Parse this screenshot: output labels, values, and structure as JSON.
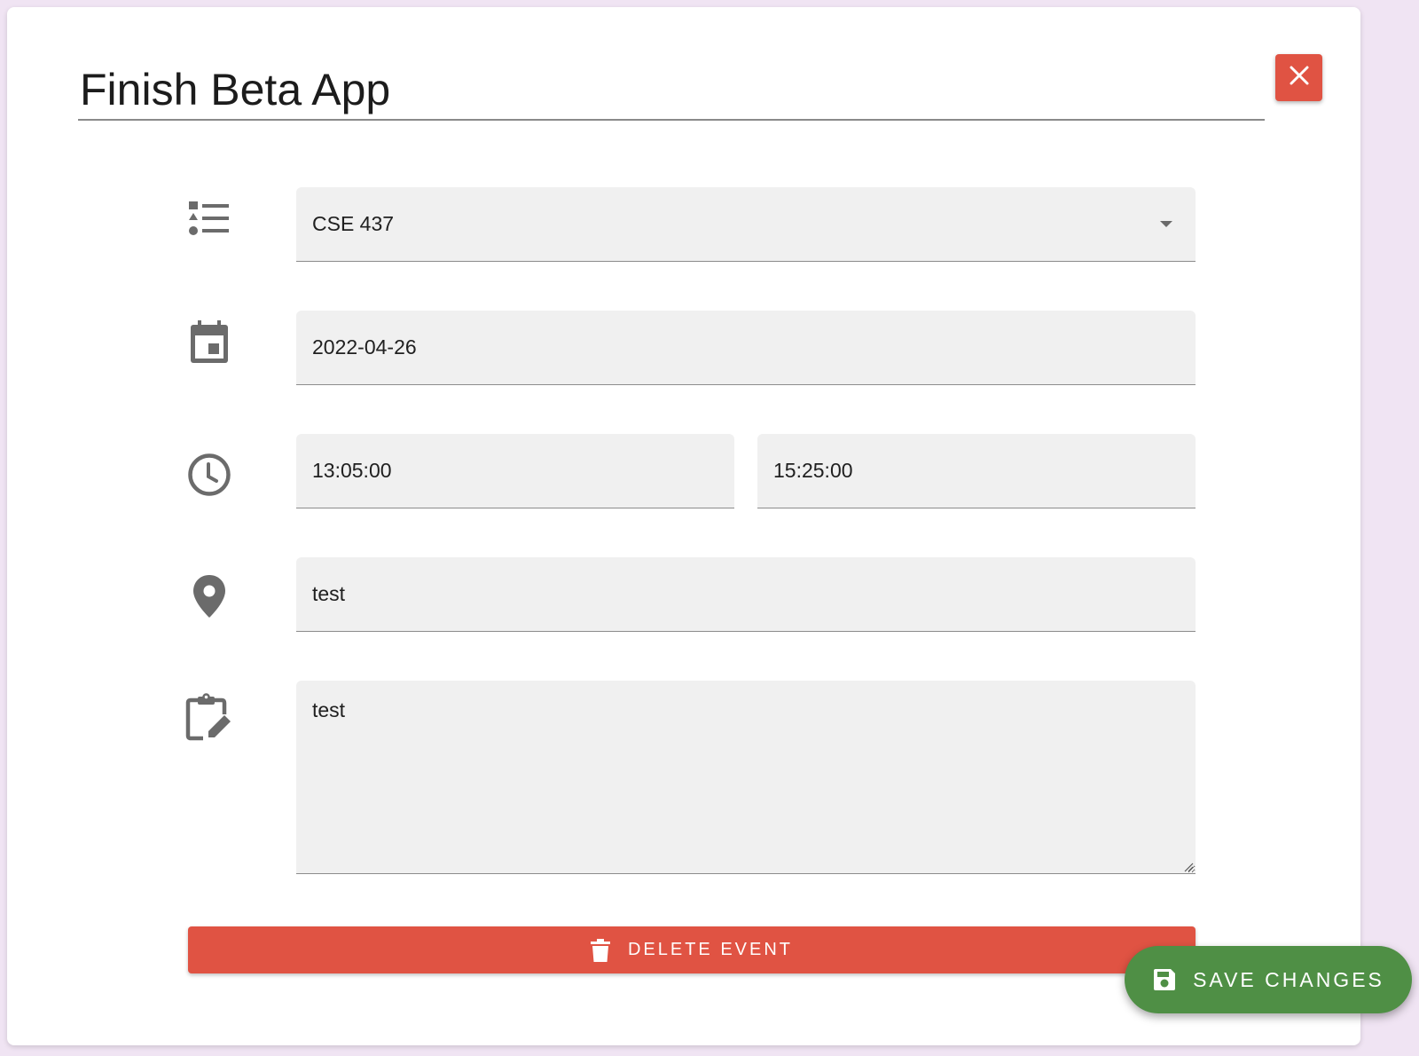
{
  "event": {
    "title": "Finish Beta App",
    "course": "CSE 437",
    "date": "2022-04-26",
    "start_time": "13:05:00",
    "end_time": "15:25:00",
    "location": "test",
    "notes": "test"
  },
  "buttons": {
    "delete_label": "DELETE EVENT",
    "save_label": "SAVE CHANGES"
  },
  "icons": {
    "close": "close-icon",
    "course": "list-icon",
    "date": "calendar-icon",
    "time": "clock-icon",
    "location": "location-pin-icon",
    "notes": "clipboard-edit-icon",
    "delete": "trash-icon",
    "save": "floppy-disk-icon",
    "select": "chevron-down-icon"
  },
  "colors": {
    "background": "#f0e4f3",
    "danger": "#e05343",
    "success": "#4f8f45",
    "field": "#f0f0f0",
    "icon": "#6b6b6b"
  }
}
